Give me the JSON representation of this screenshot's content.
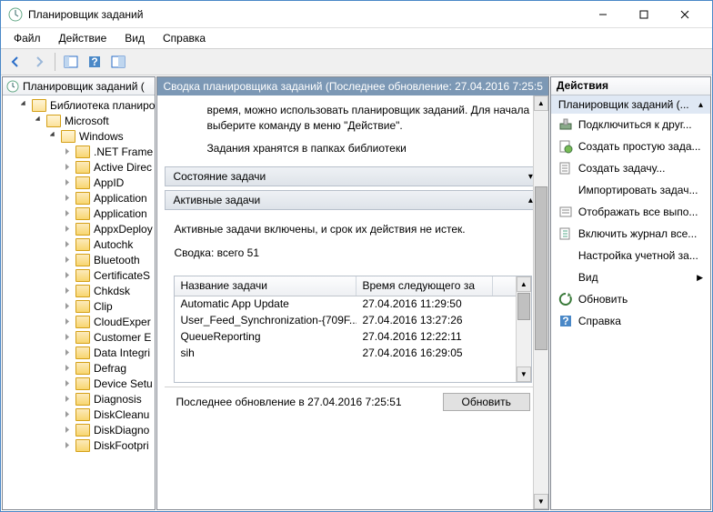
{
  "window": {
    "title": "Планировщик заданий"
  },
  "menu": {
    "file": "Файл",
    "action": "Действие",
    "view": "Вид",
    "help": "Справка"
  },
  "tree": {
    "root": "Планировщик заданий (",
    "lib": "Библиотека планиро",
    "ms": "Microsoft",
    "win": "Windows",
    "items": [
      ".NET Frame",
      "Active Direc",
      "AppID",
      "Application",
      "Application",
      "AppxDeploy",
      "Autochk",
      "Bluetooth",
      "CertificateS",
      "Chkdsk",
      "Clip",
      "CloudExper",
      "Customer E",
      "Data Integri",
      "Defrag",
      "Device Setu",
      "Diagnosis",
      "DiskCleanu",
      "DiskDiagno",
      "DiskFootpri"
    ]
  },
  "center": {
    "header": "Сводка планировщика заданий (Последнее обновление: 27.04.2016 7:25:5",
    "info1": "время, можно использовать планировщик заданий. Для начала выберите команду в меню \"Действие\".",
    "info2": "Задания хранятся в папках библиотеки",
    "section1": "Состояние задачи",
    "section2": "Активные задачи",
    "active_text": "Активные задачи включены, и срок их действия не истек.",
    "summary": "Сводка: всего 51",
    "table": {
      "col_name": "Название задачи",
      "col_time": "Время следующего за",
      "rows": [
        {
          "name": "Automatic App Update",
          "time": "27.04.2016 11:29:50"
        },
        {
          "name": "User_Feed_Synchronization-{709F...",
          "time": "27.04.2016 13:27:26"
        },
        {
          "name": "QueueReporting",
          "time": "27.04.2016 12:22:11"
        },
        {
          "name": "sih",
          "time": "27.04.2016 16:29:05"
        }
      ]
    },
    "status": "Последнее обновление в 27.04.2016 7:25:51",
    "refresh": "Обновить"
  },
  "actions": {
    "header": "Действия",
    "subheader": "Планировщик заданий (...",
    "items": [
      "Подключиться к друг...",
      "Создать простую зада...",
      "Создать задачу...",
      "Импортировать задач...",
      "Отображать все выпо...",
      "Включить журнал все...",
      "Настройка учетной за...",
      "Вид",
      "Обновить",
      "Справка"
    ]
  }
}
